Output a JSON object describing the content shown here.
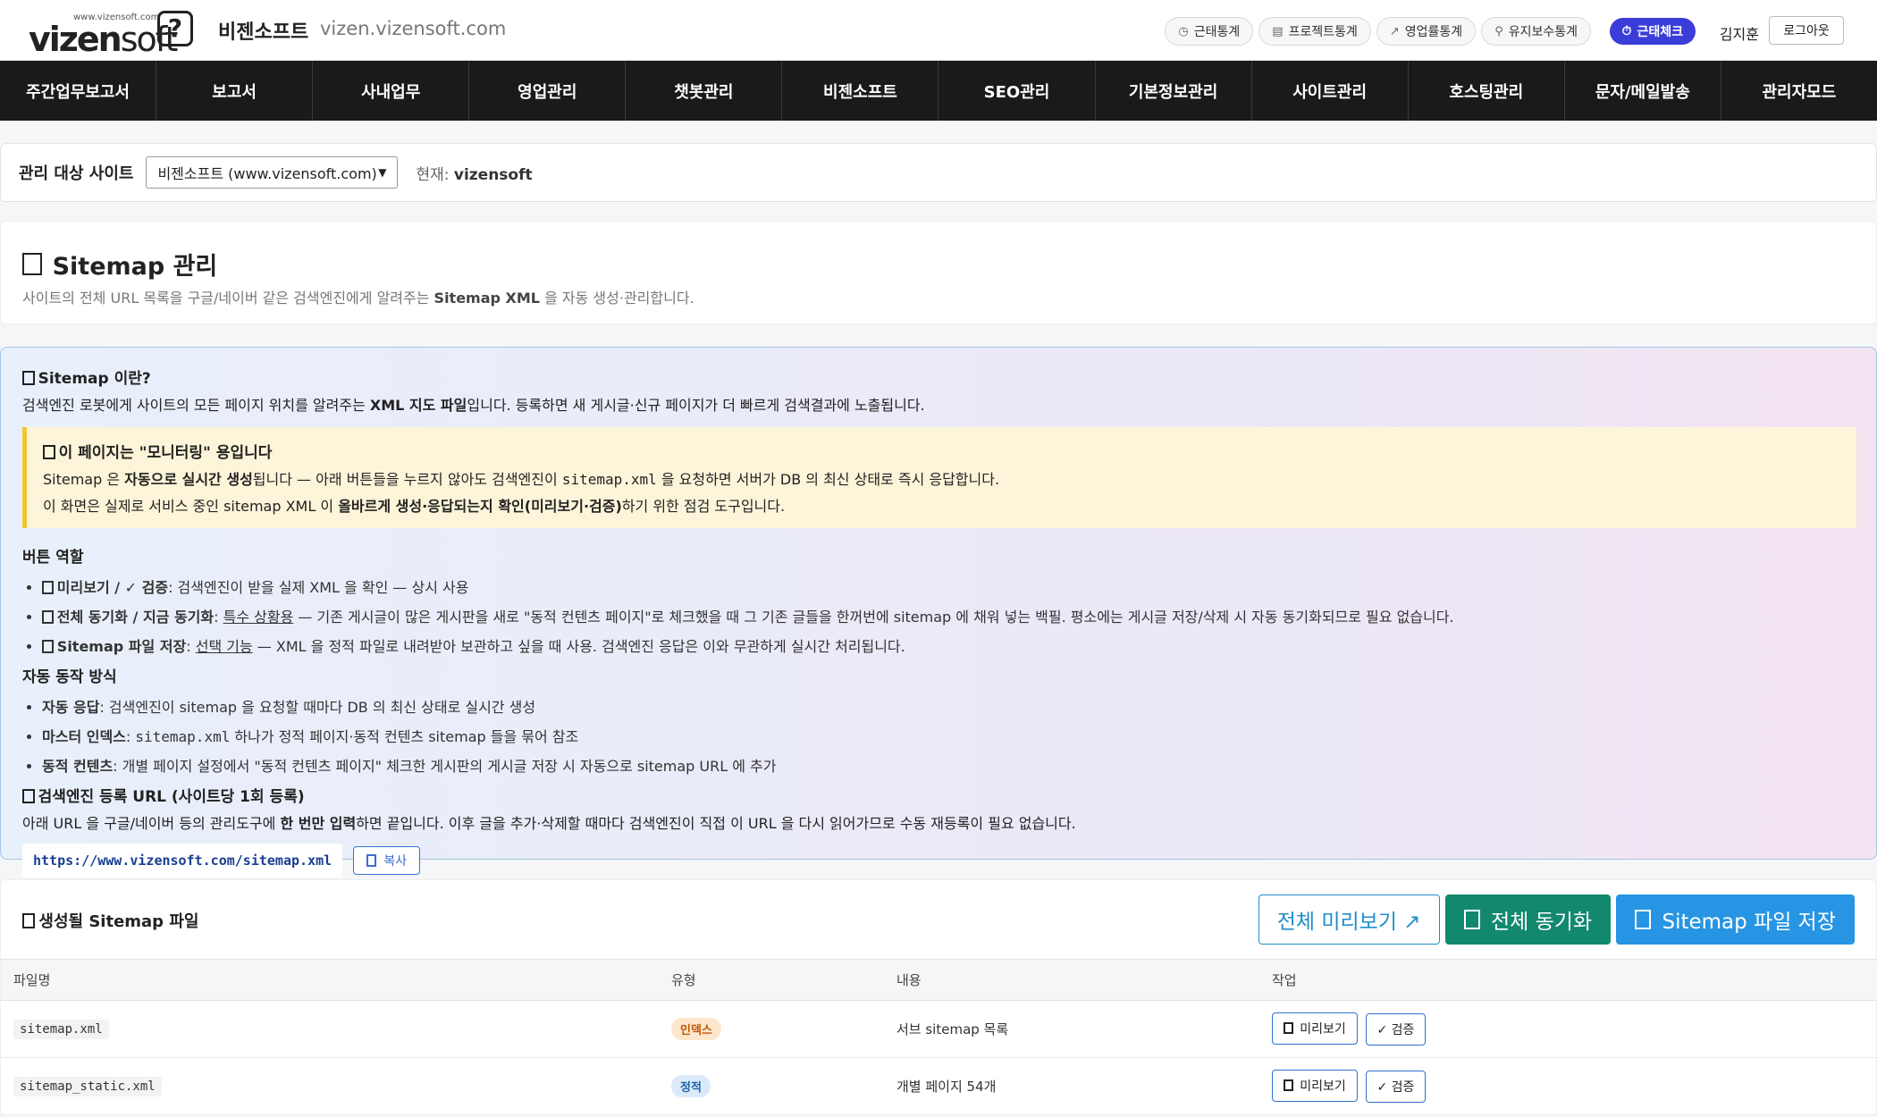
{
  "header": {
    "logo_url_text": "www.vizensoft.com",
    "logo_word_bold": "vizen",
    "logo_word_light": "soft",
    "logo_symbol": "?",
    "brand_name": "비젠소프트",
    "brand_domain": "vizen.vizensoft.com",
    "pills": [
      {
        "icon": "clock-icon",
        "glyph": "◷",
        "label": "근태통계"
      },
      {
        "icon": "clipboard-icon",
        "glyph": "▤",
        "label": "프로젝트통계"
      },
      {
        "icon": "trend-up-icon",
        "glyph": "↗",
        "label": "영업률통계"
      },
      {
        "icon": "wrench-icon",
        "glyph": "⚲",
        "label": "유지보수통계"
      }
    ],
    "primary_pill": {
      "icon": "stopwatch-icon",
      "glyph": "⏱",
      "label": "근태체크"
    },
    "user_name": "김지훈",
    "logout_label": "로그아웃"
  },
  "nav": {
    "items": [
      "주간업무보고서",
      "보고서",
      "사내업무",
      "영업관리",
      "챗봇관리",
      "비젠소프트",
      "SEO관리",
      "기본정보관리",
      "사이트관리",
      "호스팅관리",
      "문자/메일발송",
      "관리자모드"
    ]
  },
  "site_bar": {
    "label": "관리 대상 사이트",
    "selected": "비젠소프트 (www.vizensoft.com)",
    "current_prefix": "현재:",
    "current_value": "vizensoft"
  },
  "title_card": {
    "title": "Sitemap 관리",
    "desc_pre": "사이트의 전체 URL 목록을 구글/네이버 같은 검색엔진에게 알려주는 ",
    "desc_bold": "Sitemap XML",
    "desc_post": " 을 자동 생성·관리합니다."
  },
  "info": {
    "what_title": "Sitemap 이란?",
    "what_pre": "검색엔진 로봇에게 사이트의 모든 페이지 위치를 알려주는 ",
    "what_bold": "XML 지도 파일",
    "what_post": "입니다. 등록하면 새 게시글·신규 페이지가 더 빠르게 검색결과에 노출됩니다.",
    "note_title": "이 페이지는 \"모니터링\" 용입니다",
    "note_l1_a": "Sitemap 은 ",
    "note_l1_b": "자동으로 실시간 생성",
    "note_l1_c": "됩니다 — 아래 버튼들을 누르지 않아도 검색엔진이 ",
    "note_l1_code": "sitemap.xml",
    "note_l1_d": " 을 요청하면 서버가 DB 의 최신 상태로 즉시 응답합니다.",
    "note_l2_a": "이 화면은 실제로 서비스 중인 sitemap XML 이 ",
    "note_l2_b": "올바르게 생성·응답되는지 확인(미리보기·검증)",
    "note_l2_c": "하기 위한 점검 도구입니다.",
    "roles_title": "버튼 역할",
    "roles": [
      {
        "bold": "미리보기 / ✓ 검증",
        "link": "",
        "text": ": 검색엔진이 받을 실제 XML 을 확인 — 상시 사용"
      },
      {
        "bold": "전체 동기화 / 지금 동기화",
        "link": "특수 상황용",
        "text": " — 기존 게시글이 많은 게시판을 새로 \"동적 컨텐츠 페이지\"로 체크했을 때 그 기존 글들을 한꺼번에 sitemap 에 채워 넣는 백필. 평소에는 게시글 저장/삭제 시 자동 동기화되므로 필요 없습니다."
      },
      {
        "bold": "Sitemap 파일 저장",
        "link": "선택 기능",
        "text": " — XML 을 정적 파일로 내려받아 보관하고 싶을 때 사용. 검색엔진 응답은 이와 무관하게 실시간 처리됩니다."
      }
    ],
    "auto_title": "자동 동작 방식",
    "auto": [
      {
        "bold": "자동 응답",
        "code": "",
        "text": ": 검색엔진이 sitemap 을 요청할 때마다 DB 의 최신 상태로 실시간 생성"
      },
      {
        "bold": "마스터 인덱스",
        "code": "sitemap.xml",
        "text": " 하나가 정적 페이지·동적 컨텐츠 sitemap 들을 묶어 참조"
      },
      {
        "bold": "동적 컨텐츠",
        "code": "",
        "text": ": 개별 페이지 설정에서 \"동적 컨텐츠 페이지\" 체크한 게시판의 게시글 저장 시 자동으로 sitemap URL 에 추가"
      }
    ],
    "register_title": "검색엔진 등록 URL (사이트당 1회 등록)",
    "register_pre": "아래 URL 을 구글/네이버 등의 관리도구에 ",
    "register_bold": "한 번만 입력",
    "register_post": "하면 끝입니다. 이후 글을 추가·삭제할 때마다 검색엔진이 직접 이 URL 을 다시 읽어가므로 수동 재등록이 필요 없습니다.",
    "sitemap_url": "https://www.vizensoft.com/sitemap.xml",
    "copy_label": "복사"
  },
  "files": {
    "title": "생성될 Sitemap 파일",
    "preview_all": "전체 미리보기 ↗",
    "sync_all": "전체 동기화",
    "save_file": "Sitemap 파일 저장",
    "columns": [
      "파일명",
      "유형",
      "내용",
      "작업"
    ],
    "rows": [
      {
        "file": "sitemap.xml",
        "type": "인덱스",
        "type_kind": "index",
        "content": "서브 sitemap 목록",
        "preview": "미리보기",
        "verify": "✓ 검증"
      },
      {
        "file": "sitemap_static.xml",
        "type": "정적",
        "type_kind": "static",
        "content": "개별 페이지 54개",
        "preview": "미리보기",
        "verify": "✓ 검증"
      }
    ]
  },
  "colors": {
    "nav_bg": "#1a1a1a",
    "primary": "#3b3dd9",
    "sync_green": "#12896f",
    "save_blue": "#2795e4",
    "note_bg": "#fdf5d9"
  }
}
